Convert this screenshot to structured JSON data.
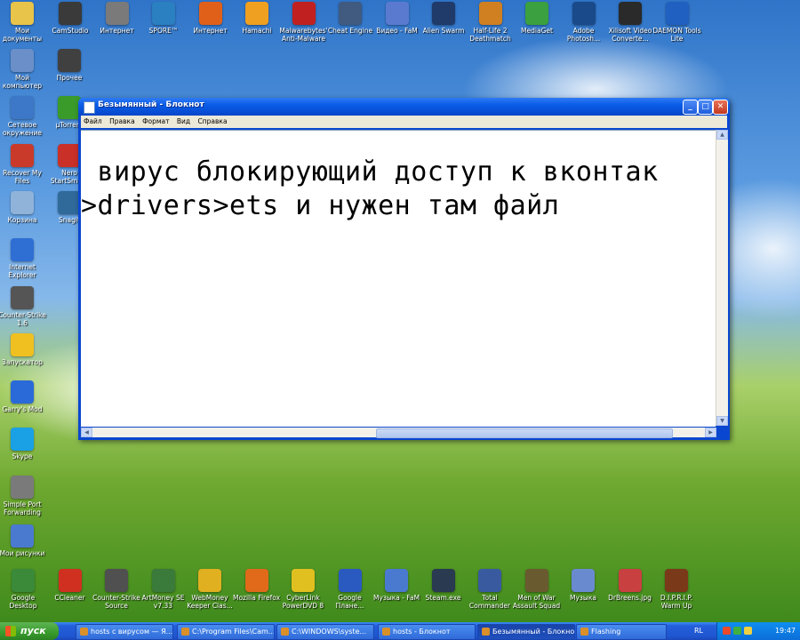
{
  "desktop": {
    "left_icons": [
      {
        "label": "Мои\nдокументы",
        "icon": "folder-icon",
        "color": "#e8c44a"
      },
      {
        "label": "Мой\nкомпьютер",
        "icon": "computer-icon",
        "color": "#6a8fc9"
      },
      {
        "label": "Сетевое\nокружение",
        "icon": "network-icon",
        "color": "#3d77c7"
      },
      {
        "label": "Recover My\nFiles",
        "icon": "recover-icon",
        "color": "#c93a2a"
      },
      {
        "label": "Корзина",
        "icon": "recycle-bin-icon",
        "color": "#8fb3d9"
      },
      {
        "label": "Internet\nExplorer",
        "icon": "ie-icon",
        "color": "#2f6fd4"
      },
      {
        "label": "Counter-Strike\n1.6",
        "icon": "cs-icon",
        "color": "#555555"
      },
      {
        "label": "Запускатор",
        "icon": "launcher-icon",
        "color": "#f0c020"
      },
      {
        "label": "Garry's Mod",
        "icon": "gmod-icon",
        "color": "#2a6ad8"
      },
      {
        "label": "Skype",
        "icon": "skype-icon",
        "color": "#1aa0e4"
      },
      {
        "label": "Simple Port\nForwarding",
        "icon": "port-forwarding-icon",
        "color": "#7a7a7a"
      },
      {
        "label": "Мои рисунки",
        "icon": "pictures-icon",
        "color": "#4a7ad0"
      }
    ],
    "col2_icons": [
      {
        "label": "Прочее",
        "icon": "misc-folder-icon",
        "color": "#404040"
      },
      {
        "label": "µTorrent",
        "icon": "utorrent-icon",
        "color": "#3a9a2a"
      },
      {
        "label": "Nero\nStartSma...",
        "icon": "nero-icon",
        "color": "#c83028"
      },
      {
        "label": "Snagit",
        "icon": "snagit-icon",
        "color": "#2f6a9a"
      }
    ],
    "top_icons": [
      {
        "label": "CamStudio",
        "icon": "camstudio-icon",
        "color": "#3a3a3a"
      },
      {
        "label": "Интернет",
        "icon": "internet-icon",
        "color": "#7a7a7a"
      },
      {
        "label": "SPORE™",
        "icon": "spore-icon",
        "color": "#2a80c0"
      },
      {
        "label": "Интернет",
        "icon": "firefox-icon",
        "color": "#e0601a"
      },
      {
        "label": "Hamachi",
        "icon": "hamachi-icon",
        "color": "#f0a020"
      },
      {
        "label": "Malwarebytes'\nAnti-Malware",
        "icon": "malwarebytes-icon",
        "color": "#c02020"
      },
      {
        "label": "Cheat Engine",
        "icon": "cheat-engine-icon",
        "color": "#405a80"
      },
      {
        "label": "Видео - FaM",
        "icon": "video-icon",
        "color": "#5a7ad0"
      },
      {
        "label": "Alien Swarm",
        "icon": "alien-swarm-icon",
        "color": "#203a6a"
      },
      {
        "label": "Half-Life 2\nDeathmatch",
        "icon": "hl2-icon",
        "color": "#d08020"
      },
      {
        "label": "MediaGet",
        "icon": "mediaget-icon",
        "color": "#3aa040"
      },
      {
        "label": "Adobe\nPhotosh...",
        "icon": "photoshop-icon",
        "color": "#1a4a8a"
      },
      {
        "label": "Xilisoft Video\nConverte...",
        "icon": "xilisoft-icon",
        "color": "#2a2a2a"
      },
      {
        "label": "DAEMON Tools\nLite",
        "icon": "daemon-tools-icon",
        "color": "#2060c0"
      }
    ],
    "bottom_icons": [
      {
        "label": "Google\nDesktop",
        "icon": "google-desktop-icon",
        "color": "#3a8a3a"
      },
      {
        "label": "CCleaner",
        "icon": "ccleaner-icon",
        "color": "#d03020"
      },
      {
        "label": "Counter-Strike\nSource",
        "icon": "css-icon",
        "color": "#505050"
      },
      {
        "label": "ArtMoney SE\nv7.33",
        "icon": "artmoney-icon",
        "color": "#3a7a3a"
      },
      {
        "label": "WebMoney\nKeeper Clas...",
        "icon": "webmoney-icon",
        "color": "#e0b020"
      },
      {
        "label": "Mozilla Firefox",
        "icon": "firefox-icon",
        "color": "#e06a1a"
      },
      {
        "label": "CyberLink\nPowerDVD 8",
        "icon": "powerdvd-icon",
        "color": "#e0c020"
      },
      {
        "label": "Google\nПлане...",
        "icon": "google-earth-icon",
        "color": "#2a5ac0"
      },
      {
        "label": "Музыка - FaM",
        "icon": "music-folder-icon",
        "color": "#4a7ad0"
      },
      {
        "label": "Steam.exe",
        "icon": "steam-icon",
        "color": "#2a3a50"
      },
      {
        "label": "Total\nCommander",
        "icon": "total-commander-icon",
        "color": "#3a5aa0"
      },
      {
        "label": "Men of War\nAssault Squad",
        "icon": "men-of-war-icon",
        "color": "#6a5a30"
      },
      {
        "label": "Музыка",
        "icon": "music-icon",
        "color": "#6a8ad0"
      },
      {
        "label": "DrBreens.jpg",
        "icon": "image-file-icon",
        "color": "#c84040"
      },
      {
        "label": "D.I.P.R.I.P.\nWarm Up",
        "icon": "diprip-icon",
        "color": "#7a3a1a"
      }
    ]
  },
  "notepad": {
    "title": "Безымянный - Блокнот",
    "menu": [
      "Файл",
      "Правка",
      "Формат",
      "Вид",
      "Справка"
    ],
    "lines": [
      " вирус блокирующий доступ к вконтак",
      ">drivers>ets и нужен там файл"
    ]
  },
  "taskbar": {
    "start_label": "пуск",
    "tasks": [
      {
        "label": "hosts с вирусом — Я...",
        "active": false
      },
      {
        "label": "C:\\Program Files\\Cam...",
        "active": false
      },
      {
        "label": "C:\\WINDOWS\\syste...",
        "active": false
      },
      {
        "label": "hosts - Блокнот",
        "active": false
      },
      {
        "label": "Безымянный - Блокнот",
        "active": true
      },
      {
        "label": "Flashing",
        "active": false
      }
    ],
    "language": "RL",
    "clock": "19:47"
  }
}
